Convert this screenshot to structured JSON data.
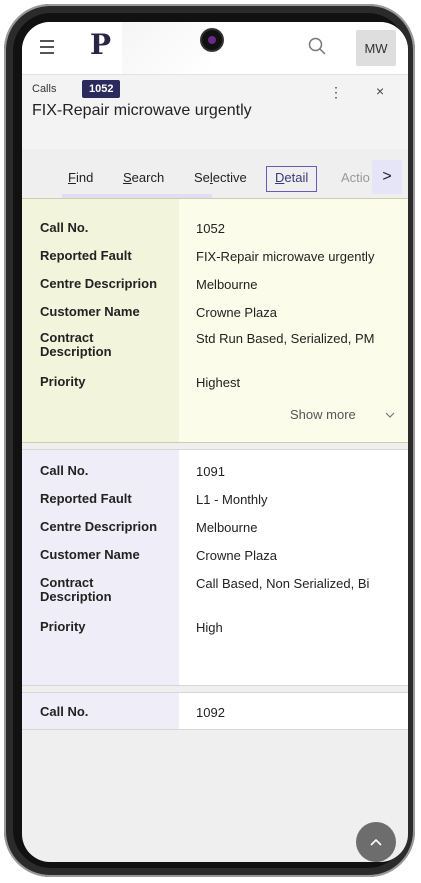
{
  "topbar": {
    "logo": "P",
    "avatar_initials": "MW"
  },
  "header": {
    "section_label": "Calls",
    "call_badge": "1052",
    "title": "FIX-Repair microwave urgently",
    "kebab": "⋮",
    "close": "×"
  },
  "tabs": {
    "find": {
      "prefix": "",
      "underlined": "F",
      "suffix": "ind"
    },
    "search": {
      "prefix": "",
      "underlined": "S",
      "suffix": "earch"
    },
    "selective": {
      "prefix": "Se",
      "underlined": "l",
      "suffix": "ective"
    },
    "detail": {
      "prefix": "",
      "underlined": "D",
      "suffix": "etail"
    },
    "action": "Actio",
    "more": ">"
  },
  "labels": {
    "call_no": "Call No.",
    "reported_fault": "Reported Fault",
    "centre": "Centre Descriprion",
    "customer": "Customer Name",
    "contract": "Contract Description",
    "priority": "Priority"
  },
  "cards": [
    {
      "call_no": "1052",
      "reported_fault": "FIX-Repair microwave urgently",
      "centre": "Melbourne",
      "customer": "Crowne Plaza",
      "contract": "Std Run Based, Serialized, PM",
      "priority": "Highest",
      "show_more": "Show more"
    },
    {
      "call_no": "1091",
      "reported_fault": "L1 - Monthly",
      "centre": "Melbourne",
      "customer": "Crowne Plaza",
      "contract": "Call Based, Non Serialized, Bi",
      "priority": "High"
    },
    {
      "call_no": "1092"
    }
  ],
  "colors": {
    "accent": "#2a2a5e",
    "active_card": "#fbfce9",
    "label_column": "#efeef8"
  }
}
